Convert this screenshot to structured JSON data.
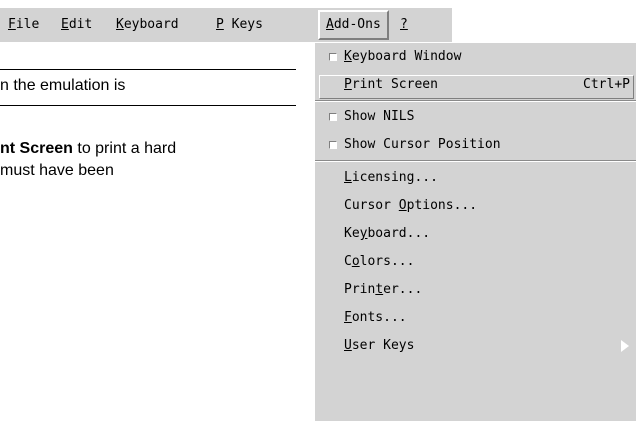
{
  "menubar": {
    "items": [
      {
        "prefix": "",
        "ul": "F",
        "rest": "ile"
      },
      {
        "prefix": "",
        "ul": "E",
        "rest": "dit"
      },
      {
        "prefix": "",
        "ul": "K",
        "rest": "eyboard"
      },
      {
        "prefix": "",
        "ul": "P",
        "rest": " Keys"
      },
      {
        "prefix": "",
        "ul": "A",
        "rest": "dd-Ons"
      },
      {
        "prefix": "",
        "ul": "?",
        "rest": ""
      }
    ]
  },
  "document": {
    "line1": "n the emulation is",
    "line2_bold": "nt Screen",
    "line2_rest": " to print a hard",
    "line3": "must have been"
  },
  "addons_menu": {
    "items": [
      {
        "pre": "",
        "ul": "K",
        "post": "eyboard Window",
        "shortcut": "",
        "checkbox": true,
        "submenu": false
      },
      {
        "pre": "",
        "ul": "P",
        "post": "rint Screen",
        "shortcut": "Ctrl+P",
        "checkbox": false,
        "submenu": false
      },
      {
        "pre": "Show NILS",
        "ul": "",
        "post": "",
        "shortcut": "",
        "checkbox": true,
        "submenu": false
      },
      {
        "pre": "Show Cursor Position",
        "ul": "",
        "post": "",
        "shortcut": "",
        "checkbox": true,
        "submenu": false
      },
      {
        "pre": "",
        "ul": "L",
        "post": "icensing...",
        "shortcut": "",
        "checkbox": false,
        "submenu": false
      },
      {
        "pre": "Cursor ",
        "ul": "O",
        "post": "ptions...",
        "shortcut": "",
        "checkbox": false,
        "submenu": false
      },
      {
        "pre": "Ke",
        "ul": "y",
        "post": "board...",
        "shortcut": "",
        "checkbox": false,
        "submenu": false
      },
      {
        "pre": "C",
        "ul": "o",
        "post": "lors...",
        "shortcut": "",
        "checkbox": false,
        "submenu": false
      },
      {
        "pre": "Prin",
        "ul": "t",
        "post": "er...",
        "shortcut": "",
        "checkbox": false,
        "submenu": false
      },
      {
        "pre": "",
        "ul": "F",
        "post": "onts...",
        "shortcut": "",
        "checkbox": false,
        "submenu": false
      },
      {
        "pre": "",
        "ul": "U",
        "post": "ser Keys",
        "shortcut": "",
        "checkbox": false,
        "submenu": true
      }
    ]
  },
  "icons": {
    "checkbox": "checkbox-indicator-icon",
    "submenu": "submenu-arrow-icon"
  }
}
